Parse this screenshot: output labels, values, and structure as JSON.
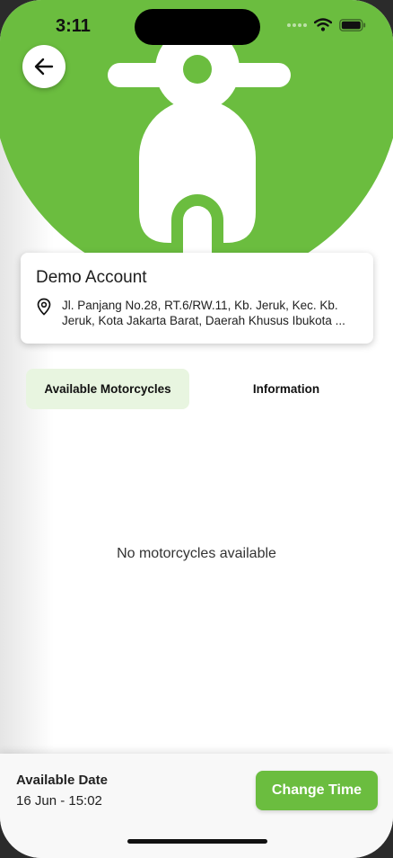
{
  "status_bar": {
    "time": "3:11"
  },
  "header": {
    "back_icon": "arrow-left-icon",
    "hero_icon": "scooter-icon",
    "brand_color": "#6bbd3f"
  },
  "store": {
    "name": "Demo Account",
    "location_icon": "map-pin-icon",
    "address": "Jl. Panjang No.28, RT.6/RW.11, Kb. Jeruk, Kec. Kb. Jeruk, Kota Jakarta Barat, Daerah Khusus Ibukota ..."
  },
  "tabs": [
    {
      "label": "Available Motorcycles",
      "active": true
    },
    {
      "label": "Information",
      "active": false
    }
  ],
  "content": {
    "empty_message": "No motorcycles available"
  },
  "footer": {
    "date_label": "Available Date",
    "date_value": "16 Jun - 15:02",
    "change_button": "Change Time",
    "button_color": "#6bbd3f"
  }
}
